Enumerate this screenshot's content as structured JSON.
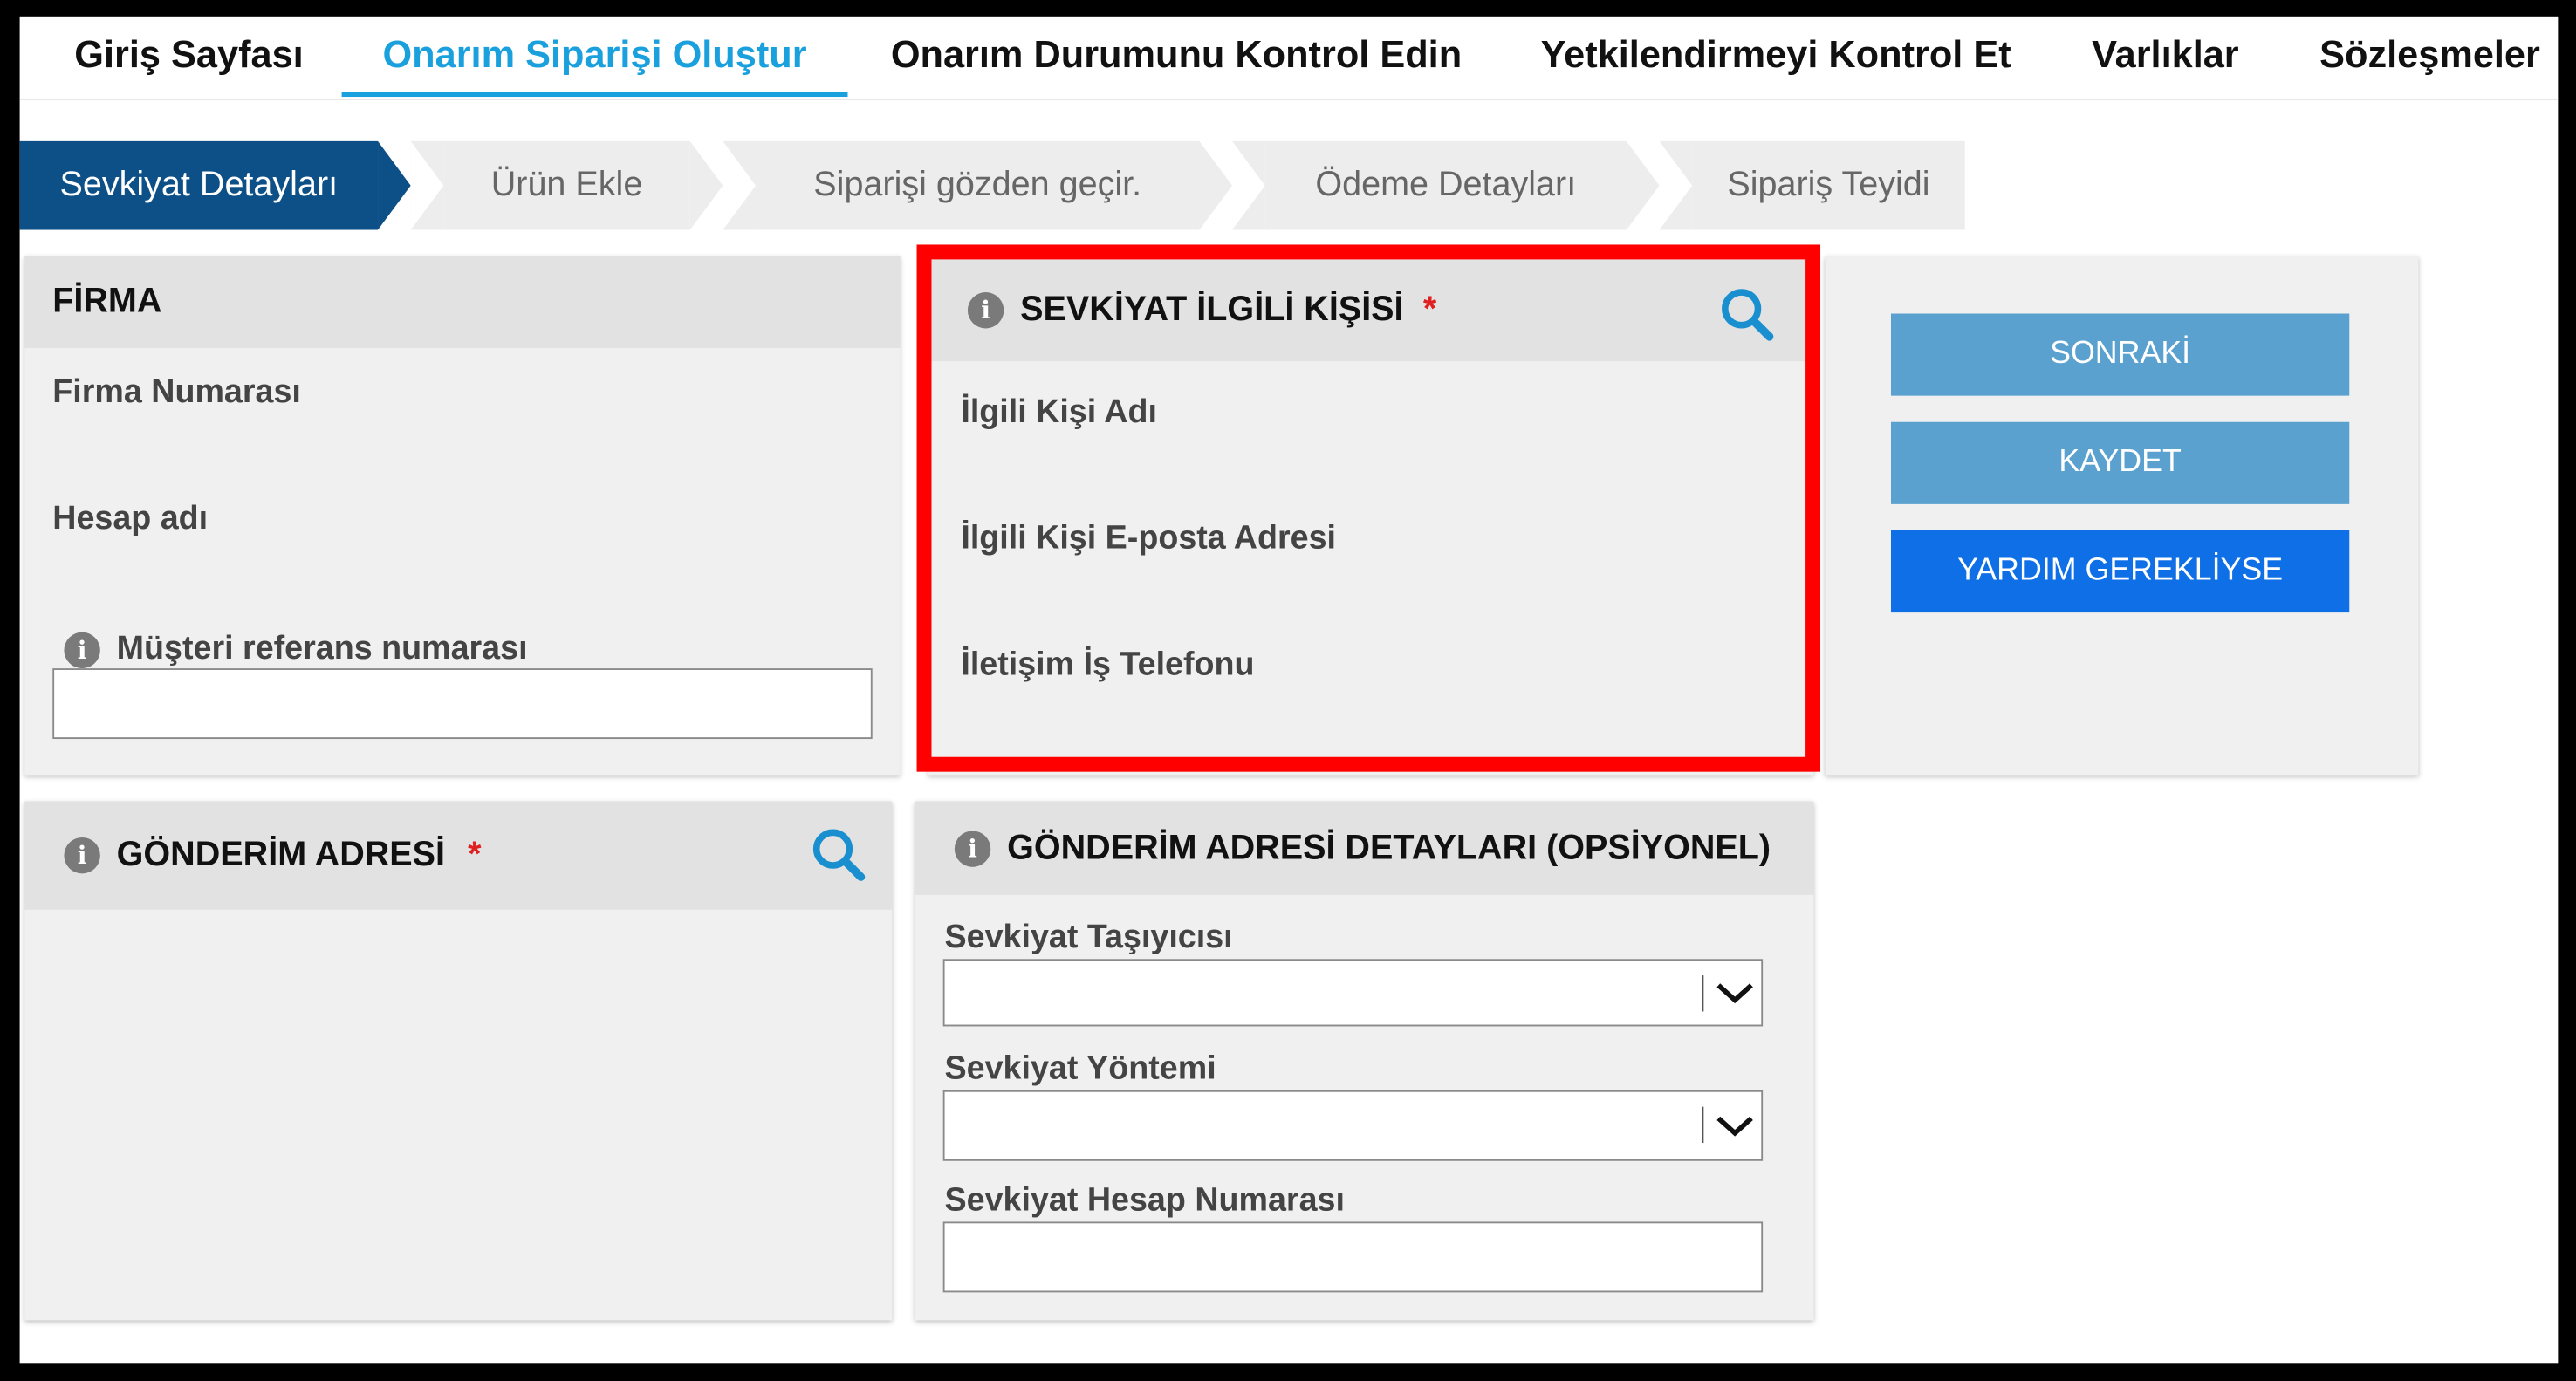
{
  "nav": {
    "tabs": [
      {
        "label": "Giriş Sayfası"
      },
      {
        "label": "Onarım Siparişi Oluştur"
      },
      {
        "label": "Onarım Durumunu Kontrol Edin"
      },
      {
        "label": "Yetkilendirmeyi Kontrol Et"
      },
      {
        "label": "Varlıklar"
      },
      {
        "label": "Sözleşmeler"
      }
    ],
    "active_index": 1
  },
  "wizard": {
    "steps": [
      {
        "label": "Sevkiyat Detayları"
      },
      {
        "label": "Ürün Ekle"
      },
      {
        "label": "Siparişi gözden geçir."
      },
      {
        "label": "Ödeme Detayları"
      },
      {
        "label": "Sipariş Teyidi"
      }
    ],
    "active_index": 0
  },
  "firma": {
    "title": "FİRMA",
    "firma_numarasi_label": "Firma Numarası",
    "hesap_adi_label": "Hesap adı",
    "musteri_ref_label": "Müşteri referans numarası",
    "musteri_ref_value": ""
  },
  "contact": {
    "title": "SEVKİYAT İLGİLİ KİŞİSİ",
    "required_mark": "*",
    "name_label": "İlgili Kişi Adı",
    "email_label": "İlgili Kişi E-posta Adresi",
    "phone_label": "İletişim İş Telefonu"
  },
  "actions": {
    "next_label": "SONRAKİ",
    "save_label": "KAYDET",
    "help_label": "YARDIM GEREKLİYSE"
  },
  "address": {
    "title": "GÖNDERİM ADRESİ",
    "required_mark": "*"
  },
  "address_details": {
    "title": "GÖNDERİM ADRESİ DETAYLARI (OPSİYONEL)",
    "carrier_label": "Sevkiyat Taşıyıcısı",
    "carrier_value": "",
    "method_label": "Sevkiyat Yöntemi",
    "method_value": "",
    "account_label": "Sevkiyat Hesap Numarası",
    "account_value": ""
  },
  "colors": {
    "accent": "#1aa0dc",
    "step_active": "#0d4f87",
    "highlight": "#ff0000",
    "button_muted": "#5aa1d0",
    "button_primary": "#0e6fe6",
    "search_icon": "#1a8fcf"
  }
}
